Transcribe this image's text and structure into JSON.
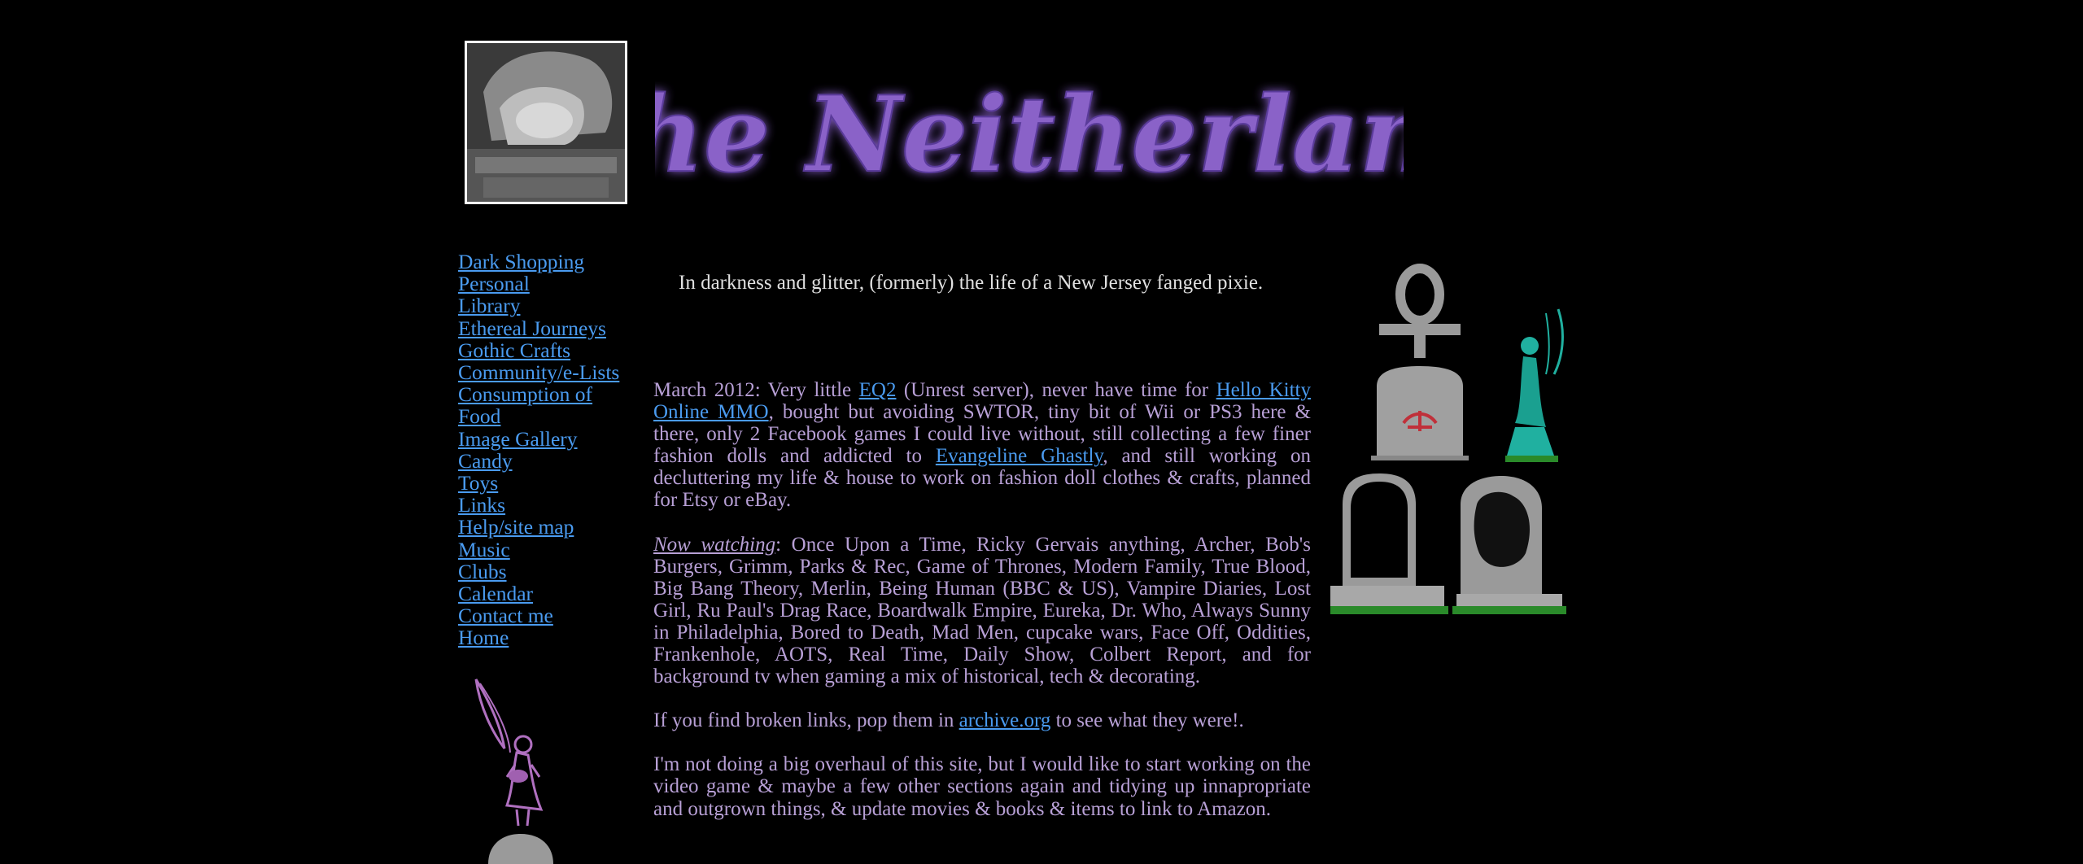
{
  "header": {
    "title": "The Neitherland"
  },
  "nav": {
    "items": [
      "Dark Shopping",
      "Personal",
      "Library",
      "Ethereal Journeys",
      "Gothic Crafts",
      "Community/e-Lists",
      "Consumption of",
      "Food",
      "Image Gallery",
      "Candy",
      "Toys",
      "Links",
      "Help/site map",
      "Music",
      "Clubs",
      "Calendar",
      "Contact me",
      "Home"
    ]
  },
  "tagline": "In darkness and glitter, (formerly) the life of a New Jersey fanged pixie.",
  "content": {
    "p1_a": "March 2012: Very little ",
    "p1_link1": "EQ2",
    "p1_b": " (Unrest server), never have time for ",
    "p1_link2": "Hello Kitty Online MMO",
    "p1_c": ", bought but avoiding SWTOR, tiny bit of Wii or PS3 here & there, only 2 Facebook games I could live without, still collecting a few finer fashion dolls and addicted to ",
    "p1_link3": "Evangeline Ghastly",
    "p1_d": ", and still working on decluttering my life & house to work on fashion doll clothes & crafts, planned for Etsy or eBay.",
    "p2_label": "Now watching",
    "p2_text": ": Once Upon a Time, Ricky Gervais anything, Archer, Bob's Burgers, Grimm, Parks & Rec, Game of Thrones, Modern Family, True Blood, Big Bang Theory, Merlin, Being Human (BBC & US), Vampire Diaries, Lost Girl, Ru Paul's Drag Race, Boardwalk Empire, Eureka, Dr. Who, Always Sunny in Philadelphia, Bored to Death, Mad Men, cupcake wars, Face Off, Oddities, Frankenhole, AOTS, Real Time, Daily Show, Colbert Report, and for background tv when gaming a mix of historical, tech & decorating.",
    "p3_a": "If you find broken links, pop them in ",
    "p3_link": "archive.org",
    "p3_b": " to see what they were!.",
    "p4": "I'm not doing a big overhaul of this site, but I would like to start working on the video game & maybe a few other sections again and tidying up innapropriate and outgrown things, & update movies & books & items to link to Amazon."
  },
  "colors": {
    "background": "#000000",
    "link": "#4a9bf0",
    "body_text": "#b8a0d6",
    "title": "#8a62c8"
  }
}
